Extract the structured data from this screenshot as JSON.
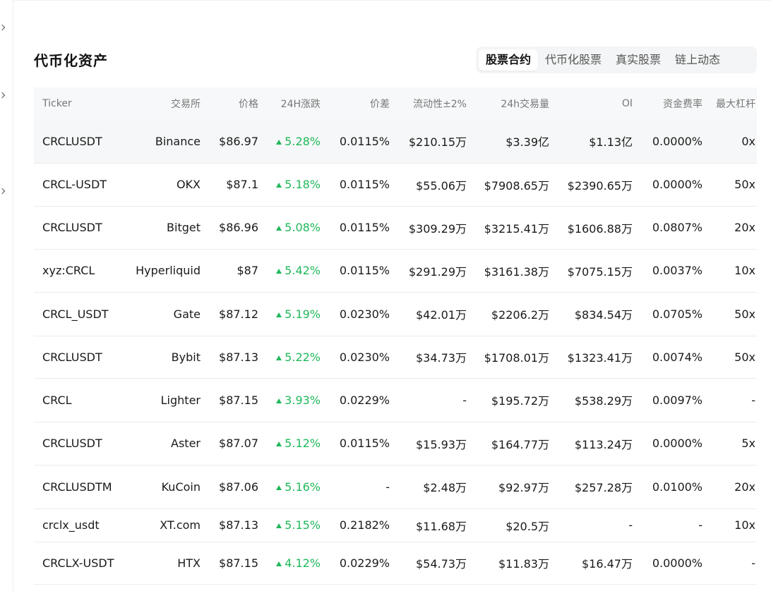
{
  "section": {
    "title": "代币化资产"
  },
  "tabs": [
    {
      "label": "股票合约",
      "active": true
    },
    {
      "label": "代币化股票",
      "active": false
    },
    {
      "label": "真实股票",
      "active": false
    },
    {
      "label": "链上动态",
      "active": false
    }
  ],
  "table": {
    "headers": [
      "Ticker",
      "交易所",
      "价格",
      "24H涨跌",
      "价差",
      "流动性±2%",
      "24h交易量",
      "OI",
      "资金费率",
      "最大杠杆"
    ],
    "rows": [
      [
        "CRCLUSDT",
        "Binance",
        "$86.97",
        "5.28%",
        "0.0115%",
        "$210.15万",
        "$3.39亿",
        "$1.13亿",
        "0.0000%",
        "0x"
      ],
      [
        "CRCL-USDT",
        "OKX",
        "$87.1",
        "5.18%",
        "0.0115%",
        "$55.06万",
        "$7908.65万",
        "$2390.65万",
        "0.0000%",
        "50x"
      ],
      [
        "CRCLUSDT",
        "Bitget",
        "$86.96",
        "5.08%",
        "0.0115%",
        "$309.29万",
        "$3215.41万",
        "$1606.88万",
        "0.0807%",
        "20x"
      ],
      [
        "xyz:CRCL",
        "Hyperliquid",
        "$87",
        "5.42%",
        "0.0115%",
        "$291.29万",
        "$3161.38万",
        "$7075.15万",
        "0.0037%",
        "10x"
      ],
      [
        "CRCL_USDT",
        "Gate",
        "$87.12",
        "5.19%",
        "0.0230%",
        "$42.01万",
        "$2206.2万",
        "$834.54万",
        "0.0705%",
        "50x"
      ],
      [
        "CRCLUSDT",
        "Bybit",
        "$87.13",
        "5.22%",
        "0.0230%",
        "$34.73万",
        "$1708.01万",
        "$1323.41万",
        "0.0074%",
        "50x"
      ],
      [
        "CRCL",
        "Lighter",
        "$87.15",
        "3.93%",
        "0.0229%",
        "-",
        "$195.72万",
        "$538.29万",
        "0.0097%",
        "-"
      ],
      [
        "CRCLUSDT",
        "Aster",
        "$87.07",
        "5.12%",
        "0.0115%",
        "$15.93万",
        "$164.77万",
        "$113.24万",
        "0.0000%",
        "5x"
      ],
      [
        "CRCLUSDTM",
        "KuCoin",
        "$87.06",
        "5.16%",
        "-",
        "$2.48万",
        "$92.97万",
        "$257.28万",
        "0.0100%",
        "20x"
      ],
      [
        "crclx_usdt",
        "XT.com",
        "$87.13",
        "5.15%",
        "0.2182%",
        "$11.68万",
        "$20.5万",
        "-",
        "-",
        "10x"
      ],
      [
        "CRCLX-USDT",
        "HTX",
        "$87.15",
        "4.12%",
        "0.0229%",
        "$54.73万",
        "$11.83万",
        "$16.47万",
        "0.0000%",
        "-"
      ]
    ]
  },
  "colors": {
    "up": "#1fb85a",
    "header_bg": "#f7f8f9",
    "highlight_row": "#f6f7f8"
  }
}
